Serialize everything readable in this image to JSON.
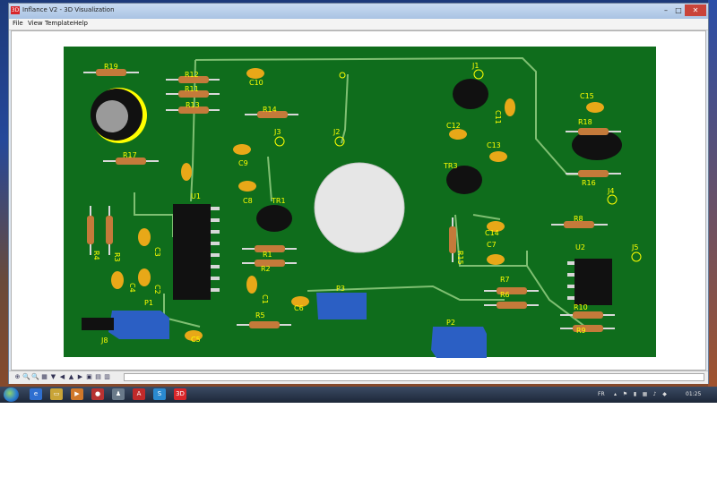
{
  "window": {
    "app_icon_text": "3D",
    "title": "Inflance V2 - 3D Visualization",
    "min": "–",
    "max": "□",
    "close": "✕"
  },
  "menu": {
    "file": "File",
    "view": "View",
    "template": "Template",
    "help": "Help"
  },
  "board": {
    "components": [
      {
        "ref": "R19"
      },
      {
        "ref": "R12"
      },
      {
        "ref": "R11"
      },
      {
        "ref": "R13"
      },
      {
        "ref": "C10"
      },
      {
        "ref": "R14"
      },
      {
        "ref": "J1"
      },
      {
        "ref": "C11"
      },
      {
        "ref": "C15"
      },
      {
        "ref": "R18"
      },
      {
        "ref": "C12"
      },
      {
        "ref": "J3"
      },
      {
        "ref": "J2"
      },
      {
        "ref": "C13"
      },
      {
        "ref": "R17"
      },
      {
        "ref": "C9"
      },
      {
        "ref": "TR3"
      },
      {
        "ref": "R16"
      },
      {
        "ref": "C8"
      },
      {
        "ref": "J4"
      },
      {
        "ref": "U1"
      },
      {
        "ref": "TR1"
      },
      {
        "ref": "R8"
      },
      {
        "ref": "R4"
      },
      {
        "ref": "R3"
      },
      {
        "ref": "C3"
      },
      {
        "ref": "R15"
      },
      {
        "ref": "C14"
      },
      {
        "ref": "U2"
      },
      {
        "ref": "J5"
      },
      {
        "ref": "R1"
      },
      {
        "ref": "C7"
      },
      {
        "ref": "C4"
      },
      {
        "ref": "C2"
      },
      {
        "ref": "R2"
      },
      {
        "ref": "C1"
      },
      {
        "ref": "R7"
      },
      {
        "ref": "P3"
      },
      {
        "ref": "R6"
      },
      {
        "ref": "C6"
      },
      {
        "ref": "P1"
      },
      {
        "ref": "R10"
      },
      {
        "ref": "R5"
      },
      {
        "ref": "P2"
      },
      {
        "ref": "R9"
      },
      {
        "ref": "J8"
      },
      {
        "ref": "C5"
      }
    ]
  },
  "statusbar": {
    "tools": [
      "⊕",
      "🔍",
      "🔍",
      "▦",
      "▼",
      "◀",
      "▲",
      "▶",
      "▣",
      "▤",
      "▥"
    ]
  },
  "taskbar": {
    "apps": [
      {
        "label": "e",
        "color": "#2f6fd0"
      },
      {
        "label": "▭",
        "color": "#c9a437"
      },
      {
        "label": "▶",
        "color": "#d0782a"
      },
      {
        "label": "●",
        "color": "#b83232"
      },
      {
        "label": "♟",
        "color": "#6a7a8a"
      },
      {
        "label": "A",
        "color": "#c02a2a"
      },
      {
        "label": "S",
        "color": "#2a8ad0"
      },
      {
        "label": "3D",
        "color": "#d8262a"
      }
    ],
    "lang": "FR",
    "clock": "01:25"
  },
  "colors": {
    "pcb": "#0f6d1c",
    "trace": "#7fbf72",
    "silk": "#ffff00"
  }
}
